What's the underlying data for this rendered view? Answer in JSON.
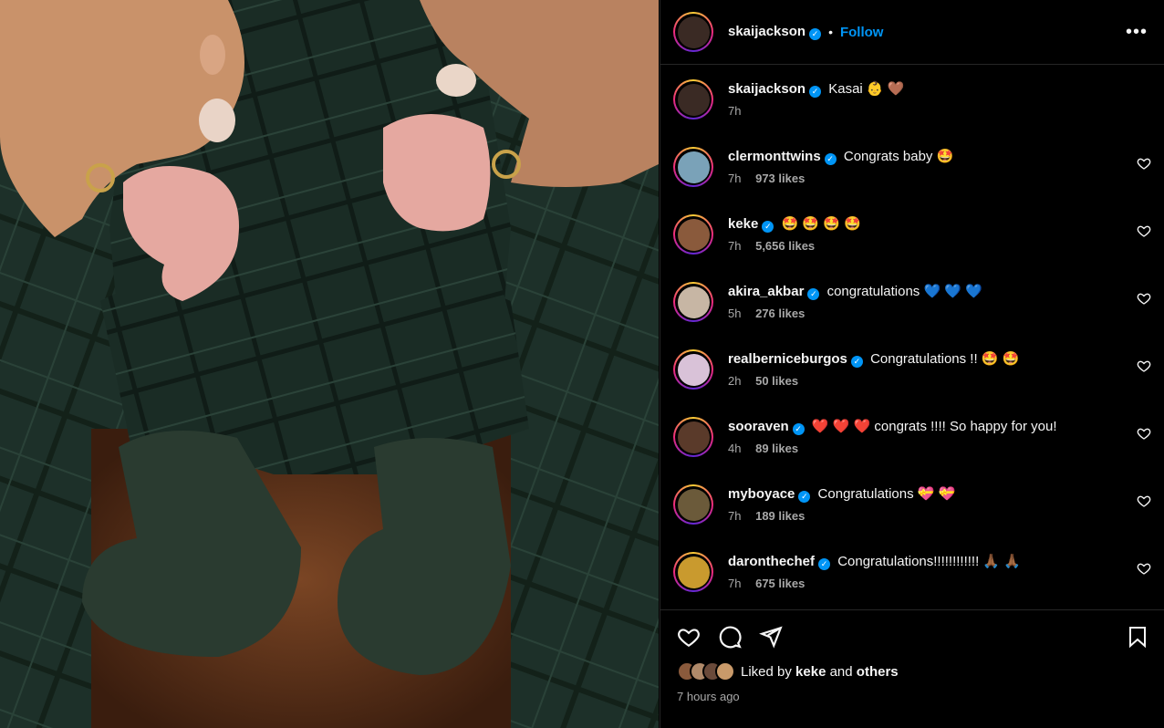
{
  "post": {
    "author": "skaijackson",
    "follow_label": "Follow",
    "separator": "•",
    "more_label": "•••",
    "caption_text": "Kasai 👶 🤎",
    "caption_time": "7h"
  },
  "comments": [
    {
      "user": "clermonttwins",
      "text": "Congrats baby 🤩",
      "time": "7h",
      "likes": "973 likes",
      "avatar_color": "#7aa2b8"
    },
    {
      "user": "keke",
      "text": "🤩 🤩 🤩 🤩",
      "time": "7h",
      "likes": "5,656 likes",
      "avatar_color": "#8a5a3c"
    },
    {
      "user": "akira_akbar",
      "text": "congratulations 💙 💙 💙",
      "time": "5h",
      "likes": "276 likes",
      "avatar_color": "#c7b6a4"
    },
    {
      "user": "realberniceburgos",
      "text": "Congratulations !! 🤩 🤩",
      "time": "2h",
      "likes": "50 likes",
      "avatar_color": "#d9c2d8"
    },
    {
      "user": "sooraven",
      "text": "❤️ ❤️ ❤️ congrats !!!! So happy for you!",
      "time": "4h",
      "likes": "89 likes",
      "avatar_color": "#5a3a2a"
    },
    {
      "user": "myboyace",
      "text": "Congratulations 💝 💝",
      "time": "7h",
      "likes": "189 likes",
      "avatar_color": "#6b5a3a"
    },
    {
      "user": "daronthechef",
      "text": "Congratulations!!!!!!!!!!!! 🙏🏾 🙏🏾",
      "time": "7h",
      "likes": "675 likes",
      "avatar_color": "#c99a2e"
    }
  ],
  "footer": {
    "liked_by_prefix": "Liked by",
    "liked_by_user": "keke",
    "liked_by_and": "and",
    "liked_by_others": "others",
    "time_ago": "7 hours ago"
  },
  "colors": {
    "accent": "#0095f6",
    "muted": "#a8a8a8",
    "border": "#262626"
  }
}
